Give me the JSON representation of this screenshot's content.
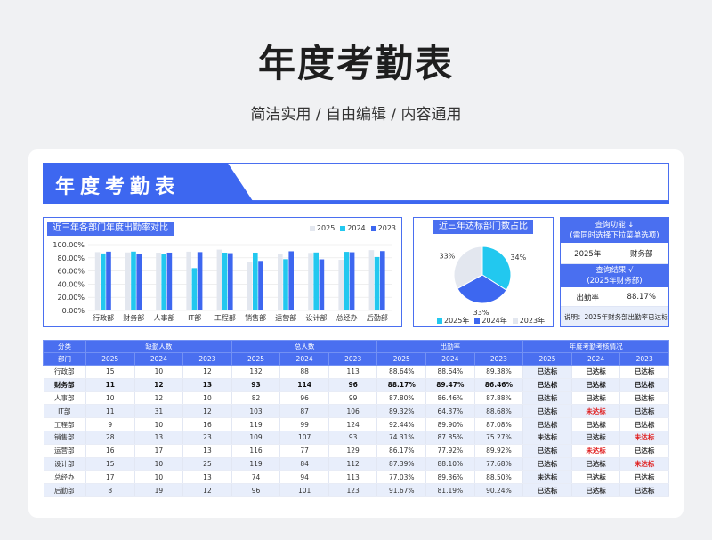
{
  "hero": {
    "title": "年度考勤表",
    "subtitle": "简洁实用 / 自由编辑 / 内容通用"
  },
  "banner": {
    "title": "年度考勤表"
  },
  "colors": {
    "c2025": "#e3e7ef",
    "c2024": "#22c8ef",
    "c2023": "#3d67f0",
    "accent": "#4a6ff0"
  },
  "bar_panel": {
    "title": "近三年各部门年度出勤率对比",
    "legend": [
      "2025",
      "2024",
      "2023"
    ]
  },
  "pie_panel": {
    "title": "近三年达标部门数占比",
    "labels": [
      "33%",
      "34%",
      "33%"
    ],
    "legend": [
      "2025年",
      "2024年",
      "2023年"
    ]
  },
  "query": {
    "header1_l1": "查询功能 ↓",
    "header1_l2": "(需同时选择下拉菜单选项)",
    "year": "2025年",
    "dept": "财务部",
    "header2_l1": "查询结果 √",
    "header2_l2": "(2025年财务部)",
    "rate_label": "出勤率",
    "rate_value": "88.17%",
    "note": "说明：2025年财务部出勤率已达标"
  },
  "chart_data": [
    {
      "type": "bar",
      "title": "近三年各部门年度出勤率对比",
      "categories": [
        "行政部",
        "财务部",
        "人事部",
        "IT部",
        "工程部",
        "销售部",
        "运营部",
        "设计部",
        "总经办",
        "后勤部"
      ],
      "ytick_labels": [
        "100.00%",
        "80.00%",
        "60.00%",
        "40.00%",
        "20.00%",
        "0.00%"
      ],
      "ylim": [
        0,
        100
      ],
      "series": [
        {
          "name": "2025",
          "values": [
            88.64,
            88.17,
            87.8,
            89.32,
            92.44,
            74.31,
            86.17,
            87.39,
            77.03,
            91.67
          ]
        },
        {
          "name": "2024",
          "values": [
            86.64,
            89.47,
            86.46,
            64.37,
            87.85,
            87.85,
            77.92,
            88.1,
            89.08,
            81.19
          ]
        },
        {
          "name": "2023",
          "values": [
            89.38,
            86.46,
            87.88,
            88.68,
            87.08,
            75.27,
            89.92,
            77.68,
            88.47,
            90.24
          ]
        }
      ]
    },
    {
      "type": "pie",
      "title": "近三年达标部门数占比",
      "series": [
        {
          "name": "2025年",
          "values": [
            33
          ]
        },
        {
          "name": "2024年",
          "values": [
            34
          ]
        },
        {
          "name": "2023年",
          "values": [
            33
          ]
        }
      ]
    }
  ],
  "table": {
    "group_headers": [
      "分类",
      "缺勤人数",
      "总人数",
      "出勤率",
      "年度考勤考核情况"
    ],
    "sub_headers": [
      "部门",
      "2025",
      "2024",
      "2023",
      "2025",
      "2024",
      "2023",
      "2025",
      "2024",
      "2023",
      "2025",
      "2024",
      "2023"
    ],
    "rows": [
      [
        "行政部",
        "15",
        "10",
        "12",
        "132",
        "88",
        "113",
        "88.64%",
        "88.64%",
        "89.38%",
        "已达标",
        "已达标",
        "已达标"
      ],
      [
        "财务部",
        "11",
        "12",
        "13",
        "93",
        "114",
        "96",
        "88.17%",
        "89.47%",
        "86.46%",
        "已达标",
        "已达标",
        "已达标"
      ],
      [
        "人事部",
        "10",
        "12",
        "10",
        "82",
        "96",
        "99",
        "87.80%",
        "86.46%",
        "87.88%",
        "已达标",
        "已达标",
        "已达标"
      ],
      [
        "IT部",
        "11",
        "31",
        "12",
        "103",
        "87",
        "106",
        "89.32%",
        "64.37%",
        "88.68%",
        "已达标",
        "未达标",
        "已达标"
      ],
      [
        "工程部",
        "9",
        "10",
        "16",
        "119",
        "99",
        "124",
        "92.44%",
        "89.90%",
        "87.08%",
        "已达标",
        "已达标",
        "已达标"
      ],
      [
        "销售部",
        "28",
        "13",
        "23",
        "109",
        "107",
        "93",
        "74.31%",
        "87.85%",
        "75.27%",
        "未达标",
        "已达标",
        "未达标"
      ],
      [
        "运营部",
        "16",
        "17",
        "13",
        "116",
        "77",
        "129",
        "86.17%",
        "77.92%",
        "89.92%",
        "已达标",
        "未达标",
        "已达标"
      ],
      [
        "设计部",
        "15",
        "10",
        "25",
        "119",
        "84",
        "112",
        "87.39%",
        "88.10%",
        "77.68%",
        "已达标",
        "已达标",
        "未达标"
      ],
      [
        "总经办",
        "17",
        "10",
        "13",
        "74",
        "94",
        "113",
        "77.03%",
        "89.36%",
        "88.50%",
        "未达标",
        "已达标",
        "已达标"
      ],
      [
        "后勤部",
        "8",
        "19",
        "12",
        "96",
        "101",
        "123",
        "91.67%",
        "81.19%",
        "90.24%",
        "已达标",
        "已达标",
        "已达标"
      ]
    ]
  }
}
